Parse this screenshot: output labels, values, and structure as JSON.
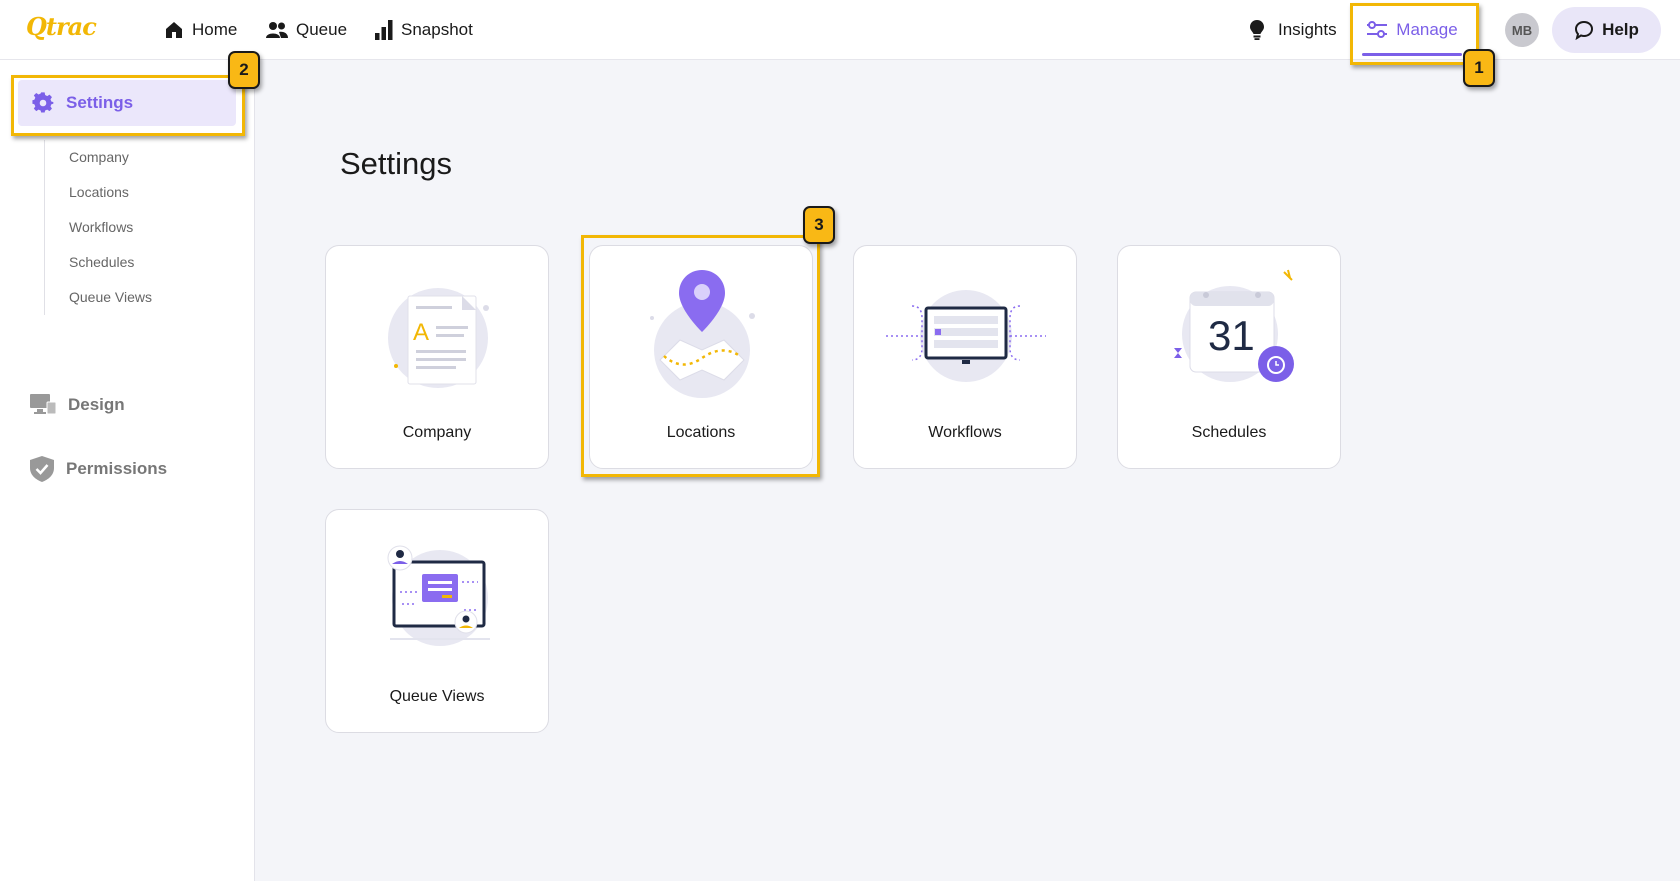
{
  "app": {
    "logo_text": "Qtrac"
  },
  "topnav": {
    "home_label": "Home",
    "queue_label": "Queue",
    "snapshot_label": "Snapshot",
    "insights_label": "Insights",
    "manage_label": "Manage",
    "avatar_initials": "MB",
    "help_label": "Help"
  },
  "sidebar": {
    "settings_label": "Settings",
    "sub_items": [
      "Company",
      "Locations",
      "Workflows",
      "Schedules",
      "Queue Views"
    ],
    "design_label": "Design",
    "permissions_label": "Permissions"
  },
  "main": {
    "title": "Settings",
    "cards": [
      "Company",
      "Locations",
      "Workflows",
      "Schedules",
      "Queue Views"
    ],
    "schedule_day": "31"
  },
  "callouts": {
    "one": "1",
    "two": "2",
    "three": "3"
  },
  "colors": {
    "accent": "#7b5fe8",
    "callout": "#f2b705",
    "background": "#f4f5f9"
  }
}
